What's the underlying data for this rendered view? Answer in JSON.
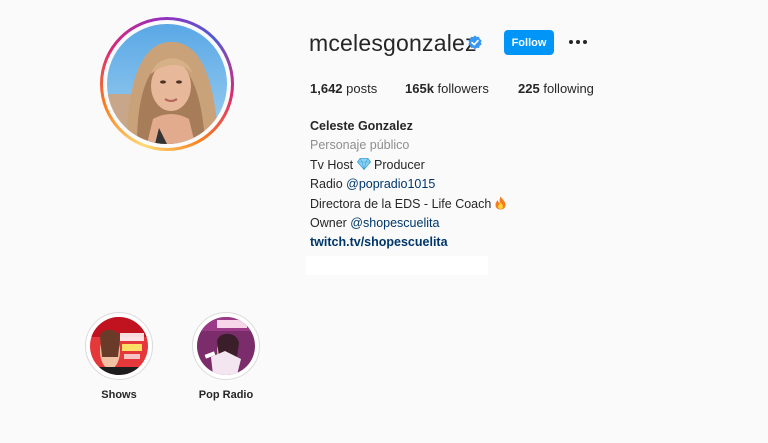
{
  "profile": {
    "username": "mcelesgonzalez",
    "verified": true,
    "follow_label": "Follow",
    "more_label": "Options"
  },
  "stats": {
    "posts_count": "1,642",
    "posts_label": "posts",
    "followers_count": "165k",
    "followers_label": "followers",
    "following_count": "225",
    "following_label": "following"
  },
  "bio": {
    "full_name": "Celeste Gonzalez",
    "category": "Personaje público",
    "line1_a": "Tv Host ",
    "line1_b": " Producer",
    "line2_a": "Radio ",
    "line2_mention": "@popradio1015",
    "line3": "Directora de la EDS - Life Coach ",
    "line4_a": "Owner ",
    "line4_mention": "@shopescuelita",
    "link": "twitch.tv/shopescuelita"
  },
  "highlights": [
    {
      "label": "Shows",
      "icon": "escuela-cover-image"
    },
    {
      "label": "Pop Radio",
      "icon": "pop-radio-cover-image"
    }
  ],
  "colors": {
    "follow_button": "#0095f6",
    "verified_badge": "#3897f0",
    "link": "#00376b",
    "muted": "#8e8e8e"
  }
}
